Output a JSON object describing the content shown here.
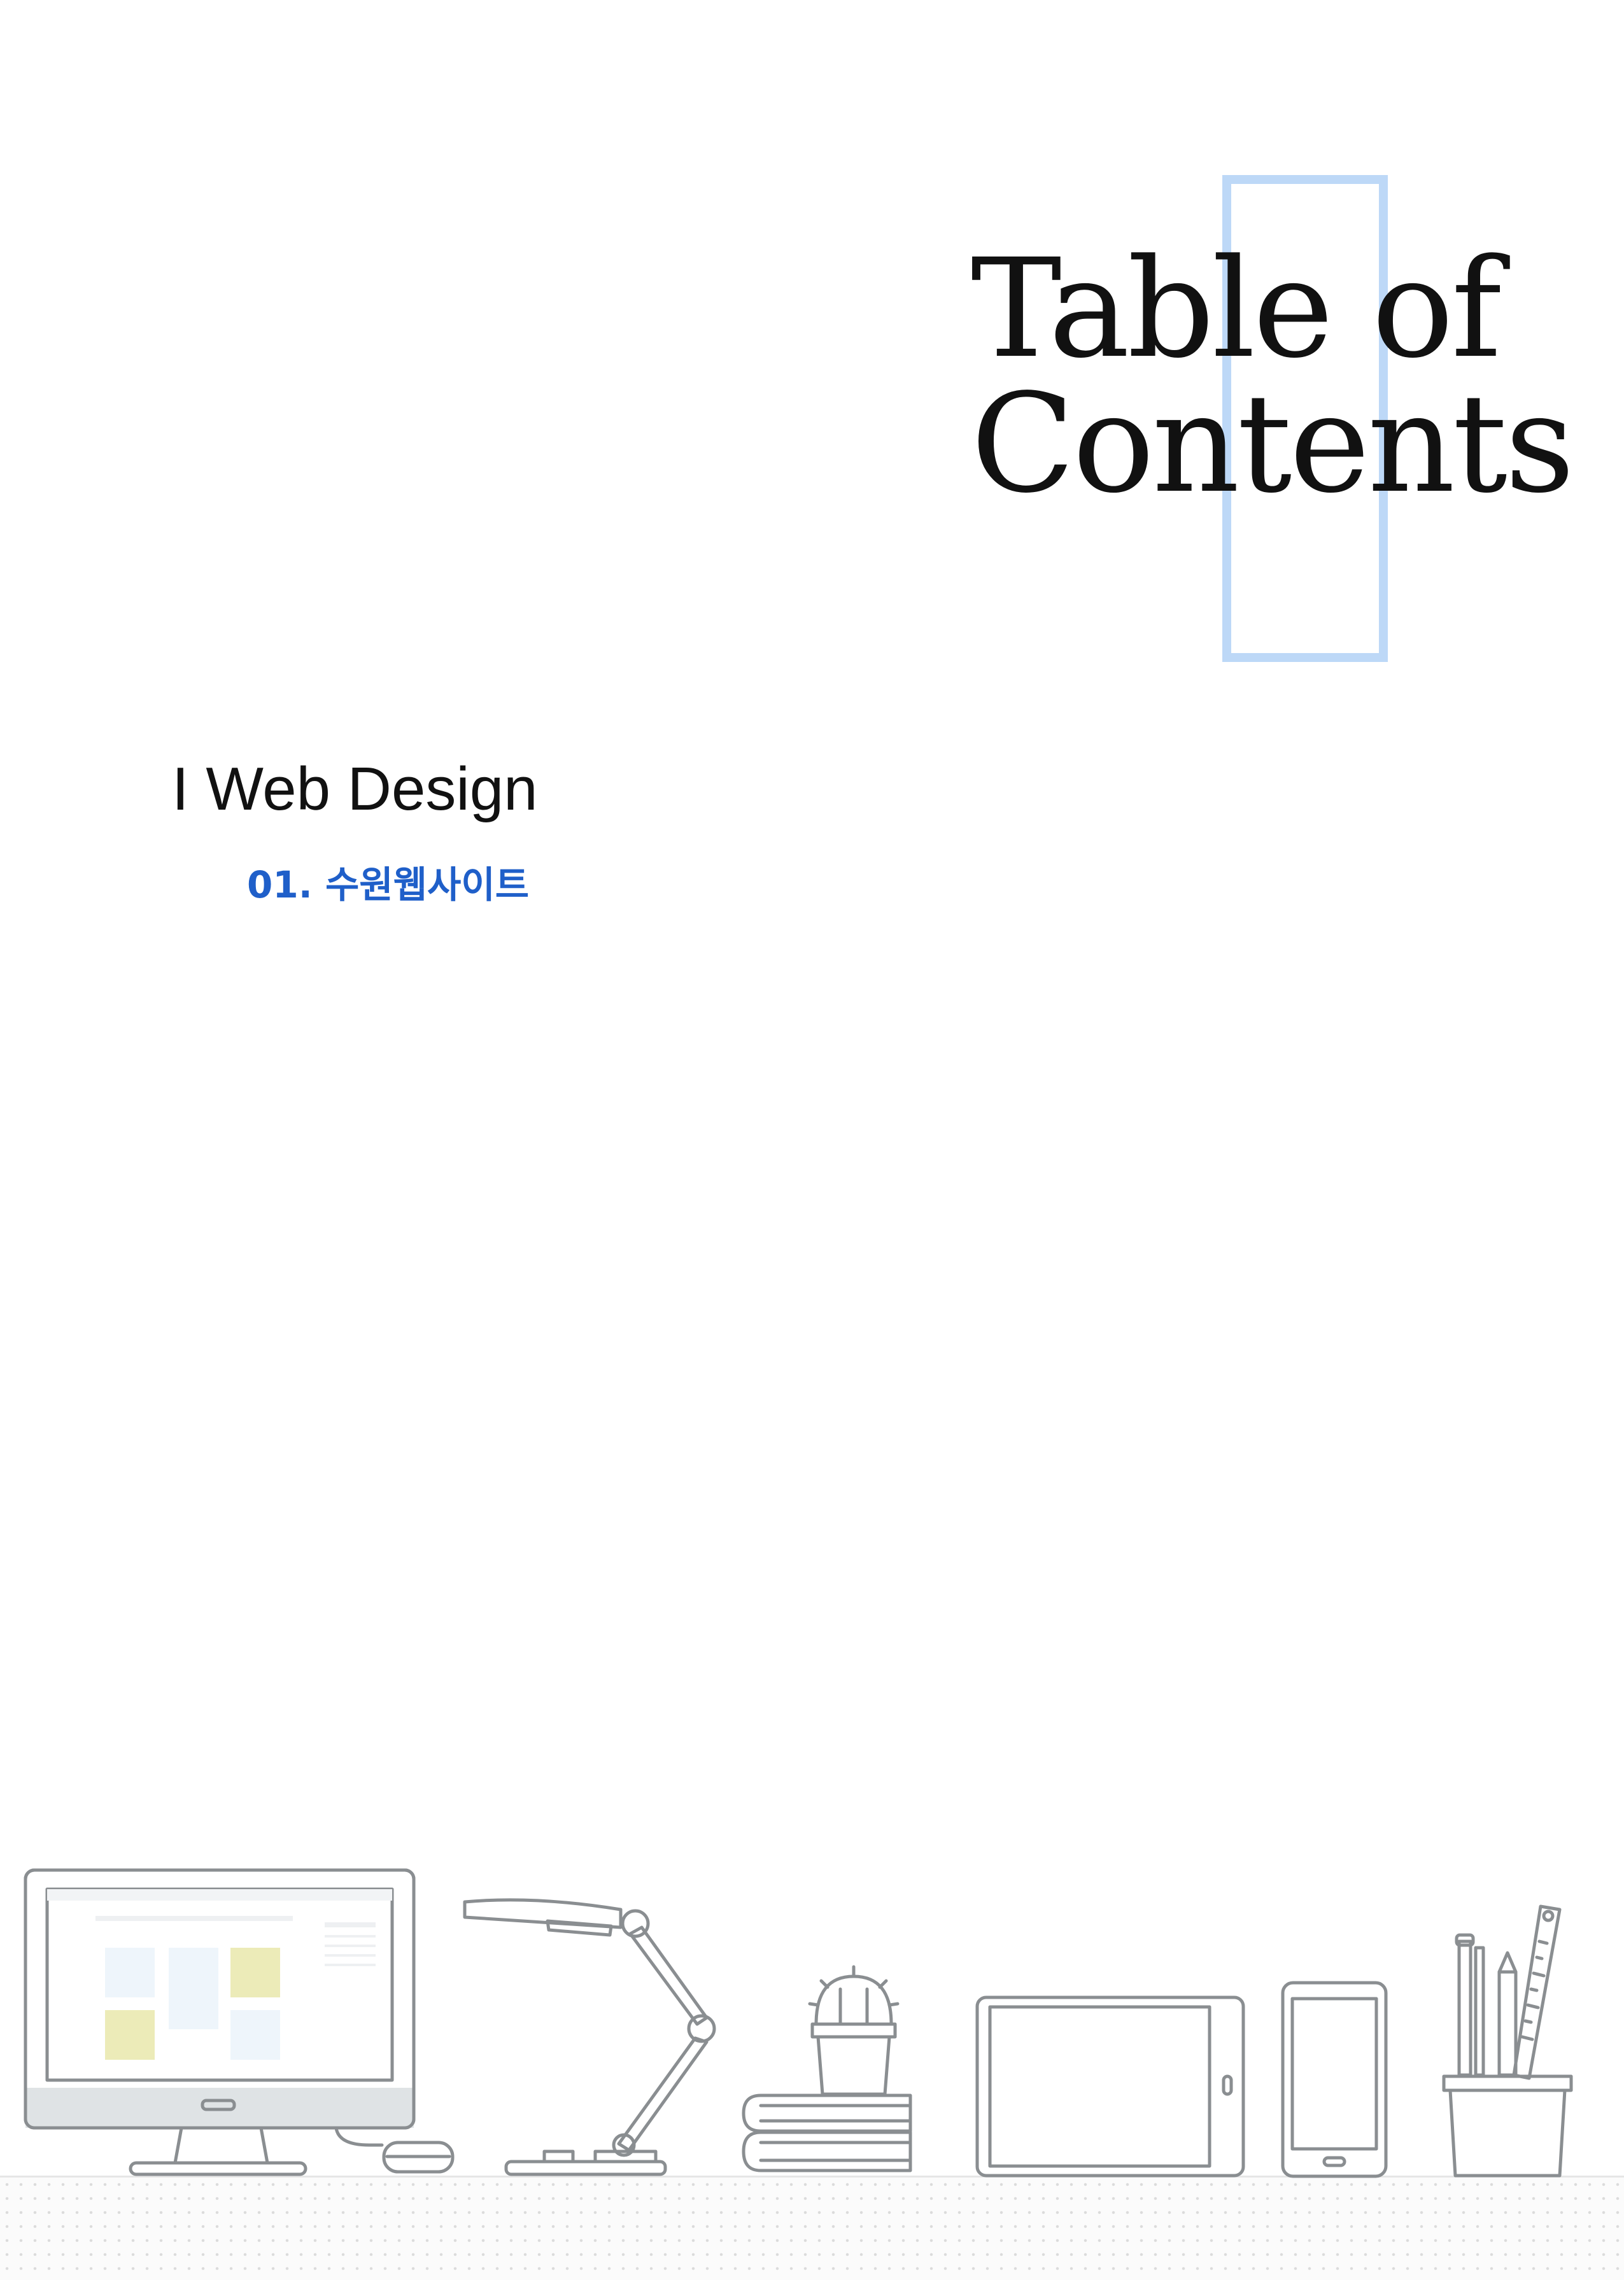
{
  "header": {
    "title_line1": "Table of",
    "title_line2": "Contents",
    "accent_color": "#bdd8f7"
  },
  "sections": [
    {
      "heading": "I Web Design",
      "items": [
        {
          "label": "01. 수원웹사이트",
          "color": "#1f5fc9"
        }
      ]
    }
  ],
  "illustration": {
    "objects": [
      "monitor-icon",
      "mouse-icon",
      "desk-lamp-icon",
      "cactus-icon",
      "books-icon",
      "tablet-icon",
      "smartphone-icon",
      "pencil-cup-icon"
    ]
  }
}
